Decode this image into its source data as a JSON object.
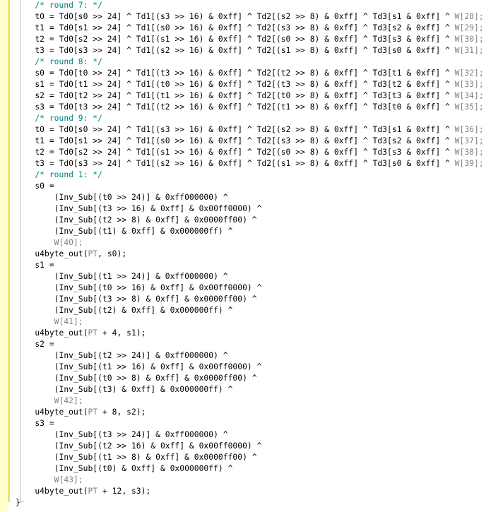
{
  "editor": {
    "lines": [
      {
        "kind": "comment",
        "text": "    /* round 7: */"
      },
      {
        "kind": "code",
        "text": "    t0 = Td0[s0 >> 24] ^ Td1[(s3 >> 16) & 0xff] ^ Td2[(s2 >> 8) & 0xff] ^ Td3[s1 & 0xff] ^ ",
        "w": "W[28];"
      },
      {
        "kind": "code",
        "text": "    t1 = Td0[s1 >> 24] ^ Td1[(s0 >> 16) & 0xff] ^ Td2[(s3 >> 8) & 0xff] ^ Td3[s2 & 0xff] ^ ",
        "w": "W[29];"
      },
      {
        "kind": "code",
        "text": "    t2 = Td0[s2 >> 24] ^ Td1[(s1 >> 16) & 0xff] ^ Td2[(s0 >> 8) & 0xff] ^ Td3[s3 & 0xff] ^ ",
        "w": "W[30];"
      },
      {
        "kind": "code",
        "text": "    t3 = Td0[s3 >> 24] ^ Td1[(s2 >> 16) & 0xff] ^ Td2[(s1 >> 8) & 0xff] ^ Td3[s0 & 0xff] ^ ",
        "w": "W[31];"
      },
      {
        "kind": "comment",
        "text": "    /* round 8: */"
      },
      {
        "kind": "code",
        "text": "    s0 = Td0[t0 >> 24] ^ Td1[(t3 >> 16) & 0xff] ^ Td2[(t2 >> 8) & 0xff] ^ Td3[t1 & 0xff] ^ ",
        "w": "W[32];"
      },
      {
        "kind": "code",
        "text": "    s1 = Td0[t1 >> 24] ^ Td1[(t0 >> 16) & 0xff] ^ Td2[(t3 >> 8) & 0xff] ^ Td3[t2 & 0xff] ^ ",
        "w": "W[33];"
      },
      {
        "kind": "code",
        "text": "    s2 = Td0[t2 >> 24] ^ Td1[(t1 >> 16) & 0xff] ^ Td2[(t0 >> 8) & 0xff] ^ Td3[t3 & 0xff] ^ ",
        "w": "W[34];"
      },
      {
        "kind": "code",
        "text": "    s3 = Td0[t3 >> 24] ^ Td1[(t2 >> 16) & 0xff] ^ Td2[(t1 >> 8) & 0xff] ^ Td3[t0 & 0xff] ^ ",
        "w": "W[35];"
      },
      {
        "kind": "comment",
        "text": "    /* round 9: */"
      },
      {
        "kind": "code",
        "text": "    t0 = Td0[s0 >> 24] ^ Td1[(s3 >> 16) & 0xff] ^ Td2[(s2 >> 8) & 0xff] ^ Td3[s1 & 0xff] ^ ",
        "w": "W[36];"
      },
      {
        "kind": "code",
        "text": "    t1 = Td0[s1 >> 24] ^ Td1[(s0 >> 16) & 0xff] ^ Td2[(s3 >> 8) & 0xff] ^ Td3[s2 & 0xff] ^ ",
        "w": "W[37];"
      },
      {
        "kind": "code",
        "text": "    t2 = Td0[s2 >> 24] ^ Td1[(s1 >> 16) & 0xff] ^ Td2[(s0 >> 8) & 0xff] ^ Td3[s3 & 0xff] ^ ",
        "w": "W[38];"
      },
      {
        "kind": "code",
        "text": "    t3 = Td0[s3 >> 24] ^ Td1[(s2 >> 16) & 0xff] ^ Td2[(s1 >> 8) & 0xff] ^ Td3[s0 & 0xff] ^ ",
        "w": "W[39];"
      },
      {
        "kind": "comment",
        "text": "    /* round 1: */"
      },
      {
        "kind": "code",
        "text": "    s0 ="
      },
      {
        "kind": "code",
        "text": "        (Inv_Sub[(t0 >> 24)] & 0xff000000) ^"
      },
      {
        "kind": "code",
        "text": "        (Inv_Sub[(t3 >> 16) & 0xff] & 0x00ff0000) ^"
      },
      {
        "kind": "code",
        "text": "        (Inv_Sub[(t2 >> 8) & 0xff] & 0x0000ff00) ^"
      },
      {
        "kind": "code",
        "text": "        (Inv_Sub[(t1) & 0xff] & 0x000000ff) ^"
      },
      {
        "kind": "code",
        "text": "        ",
        "w": "W[40];"
      },
      {
        "kind": "code",
        "text": "    u4byte_out(",
        "pt": "PT",
        "rest": ", s0);"
      },
      {
        "kind": "code",
        "text": "    s1 ="
      },
      {
        "kind": "code",
        "text": "        (Inv_Sub[(t1 >> 24)] & 0xff000000) ^"
      },
      {
        "kind": "code",
        "text": "        (Inv_Sub[(t0 >> 16) & 0xff] & 0x00ff0000) ^"
      },
      {
        "kind": "code",
        "text": "        (Inv_Sub[(t3 >> 8) & 0xff] & 0x0000ff00) ^"
      },
      {
        "kind": "code",
        "text": "        (Inv_Sub[(t2) & 0xff] & 0x000000ff) ^"
      },
      {
        "kind": "code",
        "text": "        ",
        "w": "W[41];"
      },
      {
        "kind": "code",
        "text": "    u4byte_out(",
        "pt": "PT",
        "rest": " + 4, s1);"
      },
      {
        "kind": "code",
        "text": "    s2 ="
      },
      {
        "kind": "code",
        "text": "        (Inv_Sub[(t2 >> 24)] & 0xff000000) ^"
      },
      {
        "kind": "code",
        "text": "        (Inv_Sub[(t1 >> 16) & 0xff] & 0x00ff0000) ^"
      },
      {
        "kind": "code",
        "text": "        (Inv_Sub[(t0 >> 8) & 0xff] & 0x0000ff00) ^"
      },
      {
        "kind": "code",
        "text": "        (Inv_Sub[(t3) & 0xff] & 0x000000ff) ^"
      },
      {
        "kind": "code",
        "text": "        ",
        "w": "W[42];"
      },
      {
        "kind": "code",
        "text": "    u4byte_out(",
        "pt": "PT",
        "rest": " + 8, s2);"
      },
      {
        "kind": "code",
        "text": "    s3 ="
      },
      {
        "kind": "code",
        "text": "        (Inv_Sub[(t3 >> 24)] & 0xff000000) ^"
      },
      {
        "kind": "code",
        "text": "        (Inv_Sub[(t2 >> 16) & 0xff] & 0x00ff0000) ^"
      },
      {
        "kind": "code",
        "text": "        (Inv_Sub[(t1 >> 8) & 0xff] & 0x0000ff00) ^"
      },
      {
        "kind": "code",
        "text": "        (Inv_Sub[(t0) & 0xff] & 0x000000ff) ^"
      },
      {
        "kind": "code",
        "text": "        ",
        "w": "W[43];"
      },
      {
        "kind": "code",
        "text": "    u4byte_out(",
        "pt": "PT",
        "rest": " + 12, s3);"
      },
      {
        "kind": "code",
        "text": "}"
      }
    ]
  },
  "colors": {
    "background": "#ffffff",
    "text": "#000000",
    "comment": "#008080",
    "dim_identifier": "#808080",
    "gutter_change": "#ffffcc",
    "gutter_bar": "#e8e86a"
  }
}
